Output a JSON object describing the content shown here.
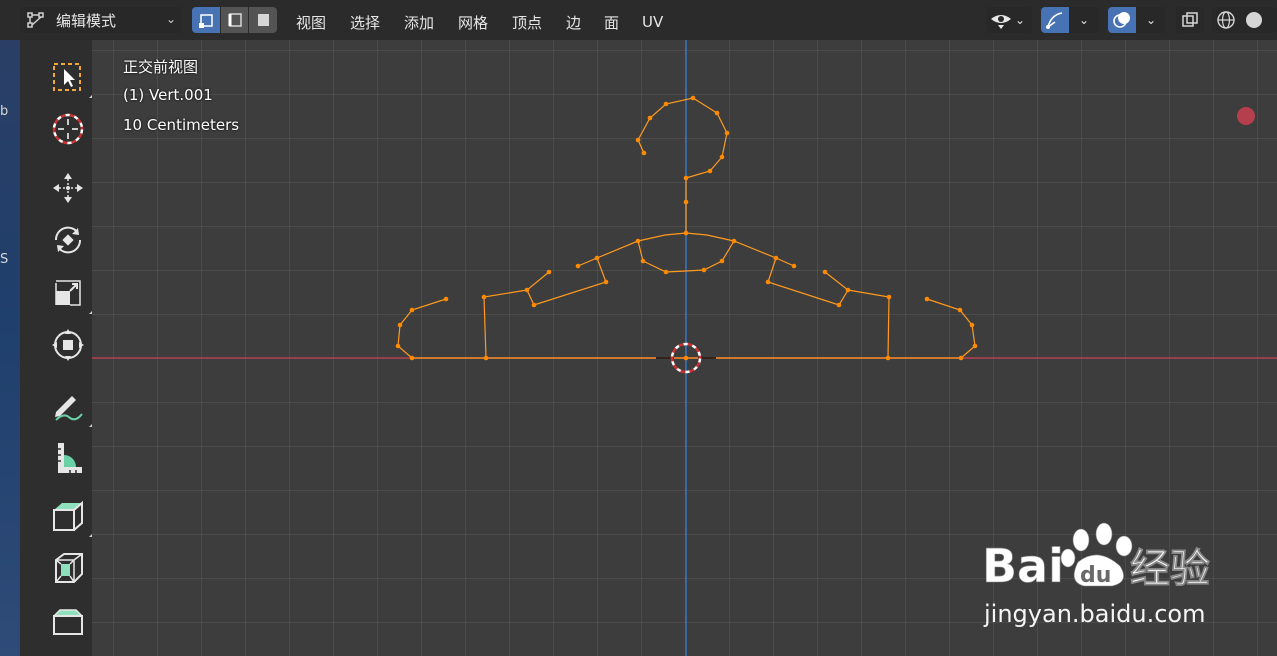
{
  "header": {
    "mode_label": "编辑模式",
    "menus": [
      "视图",
      "选择",
      "添加",
      "网格",
      "顶点",
      "边",
      "面",
      "UV"
    ]
  },
  "viewport": {
    "hud": {
      "view_name": "正交前视图",
      "object_info": "(1) Vert.001",
      "scale": "10 Centimeters"
    }
  },
  "left_edge": {
    "fragments": [
      "b",
      "S"
    ]
  },
  "toolbar": {
    "tools": [
      {
        "name": "select-box-icon",
        "active": true
      },
      {
        "name": "cursor-icon",
        "active": false
      },
      {
        "name": "move-icon",
        "active": false
      },
      {
        "name": "rotate-icon",
        "active": false
      },
      {
        "name": "scale-icon",
        "active": false
      },
      {
        "name": "transform-icon",
        "active": false
      },
      {
        "name": "annotate-icon",
        "active": false
      },
      {
        "name": "measure-icon",
        "active": false
      },
      {
        "name": "extrude-icon",
        "active": false
      },
      {
        "name": "inset-icon",
        "active": false
      },
      {
        "name": "bevel-icon",
        "active": false
      }
    ]
  },
  "colors": {
    "accent": "#4772b3",
    "edge": "#ff9a1f",
    "vertex": "#ff8a00",
    "x_axis": "#b3404c",
    "z_axis": "#3a78c9",
    "record_dot": "#b3404c"
  },
  "watermark": {
    "brand": "Bai du 经验",
    "url": "jingyan.baidu.com"
  }
}
